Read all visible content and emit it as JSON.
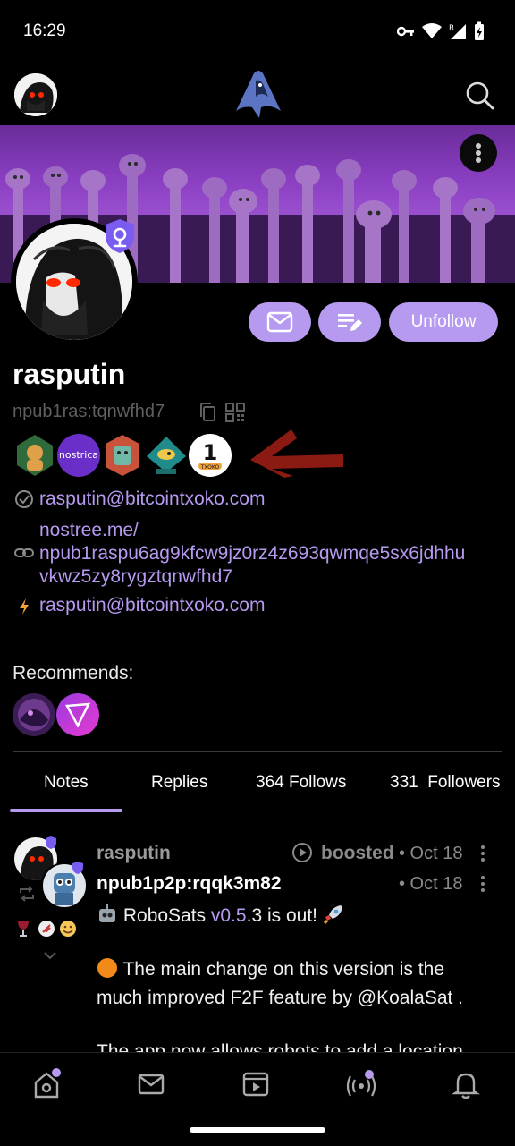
{
  "status_bar": {
    "time": "16:29"
  },
  "profile": {
    "name": "rasputin",
    "npub_short": "npub1ras:tqnwfhd7",
    "nip05": "rasputin@bitcointxoko.com",
    "website_line1": "nostree.me/",
    "website_line2": "npub1raspu6ag9kfcw9jz0rz4z693qwmqe5sx6jdhhu",
    "website_line3": "vkwz5zy8rygztqnwfhd7",
    "lightning": "rasputin@bitcointxoko.com",
    "recommends_label": "Recommends:"
  },
  "actions": {
    "unfollow_label": "Unfollow"
  },
  "badges": {
    "nostrica_text": "nostrica",
    "one_text": "1",
    "txoko_text": "TXOKO"
  },
  "tabs": [
    {
      "label": "Notes"
    },
    {
      "label": "Replies"
    },
    {
      "label": "364 Follows"
    },
    {
      "label": "331  Followers"
    }
  ],
  "note": {
    "booster": "rasputin",
    "boosted_label": "boosted",
    "boost_date": "• Oct 18",
    "author": "npub1p2p:rqqk3m82",
    "date": "• Oct 18",
    "line1_pre": "RoboSats",
    "line1_version": "v0.5",
    "line1_post": ".3 is out!",
    "para2_line1": "The main change on this version is the",
    "para2_line2": "much improved F2F feature by @KoalaSat .",
    "para3_line1": "The app now allows robots to add a location"
  },
  "colors": {
    "accent": "#b69af0",
    "background": "#000000",
    "muted": "#5f5f5f"
  }
}
